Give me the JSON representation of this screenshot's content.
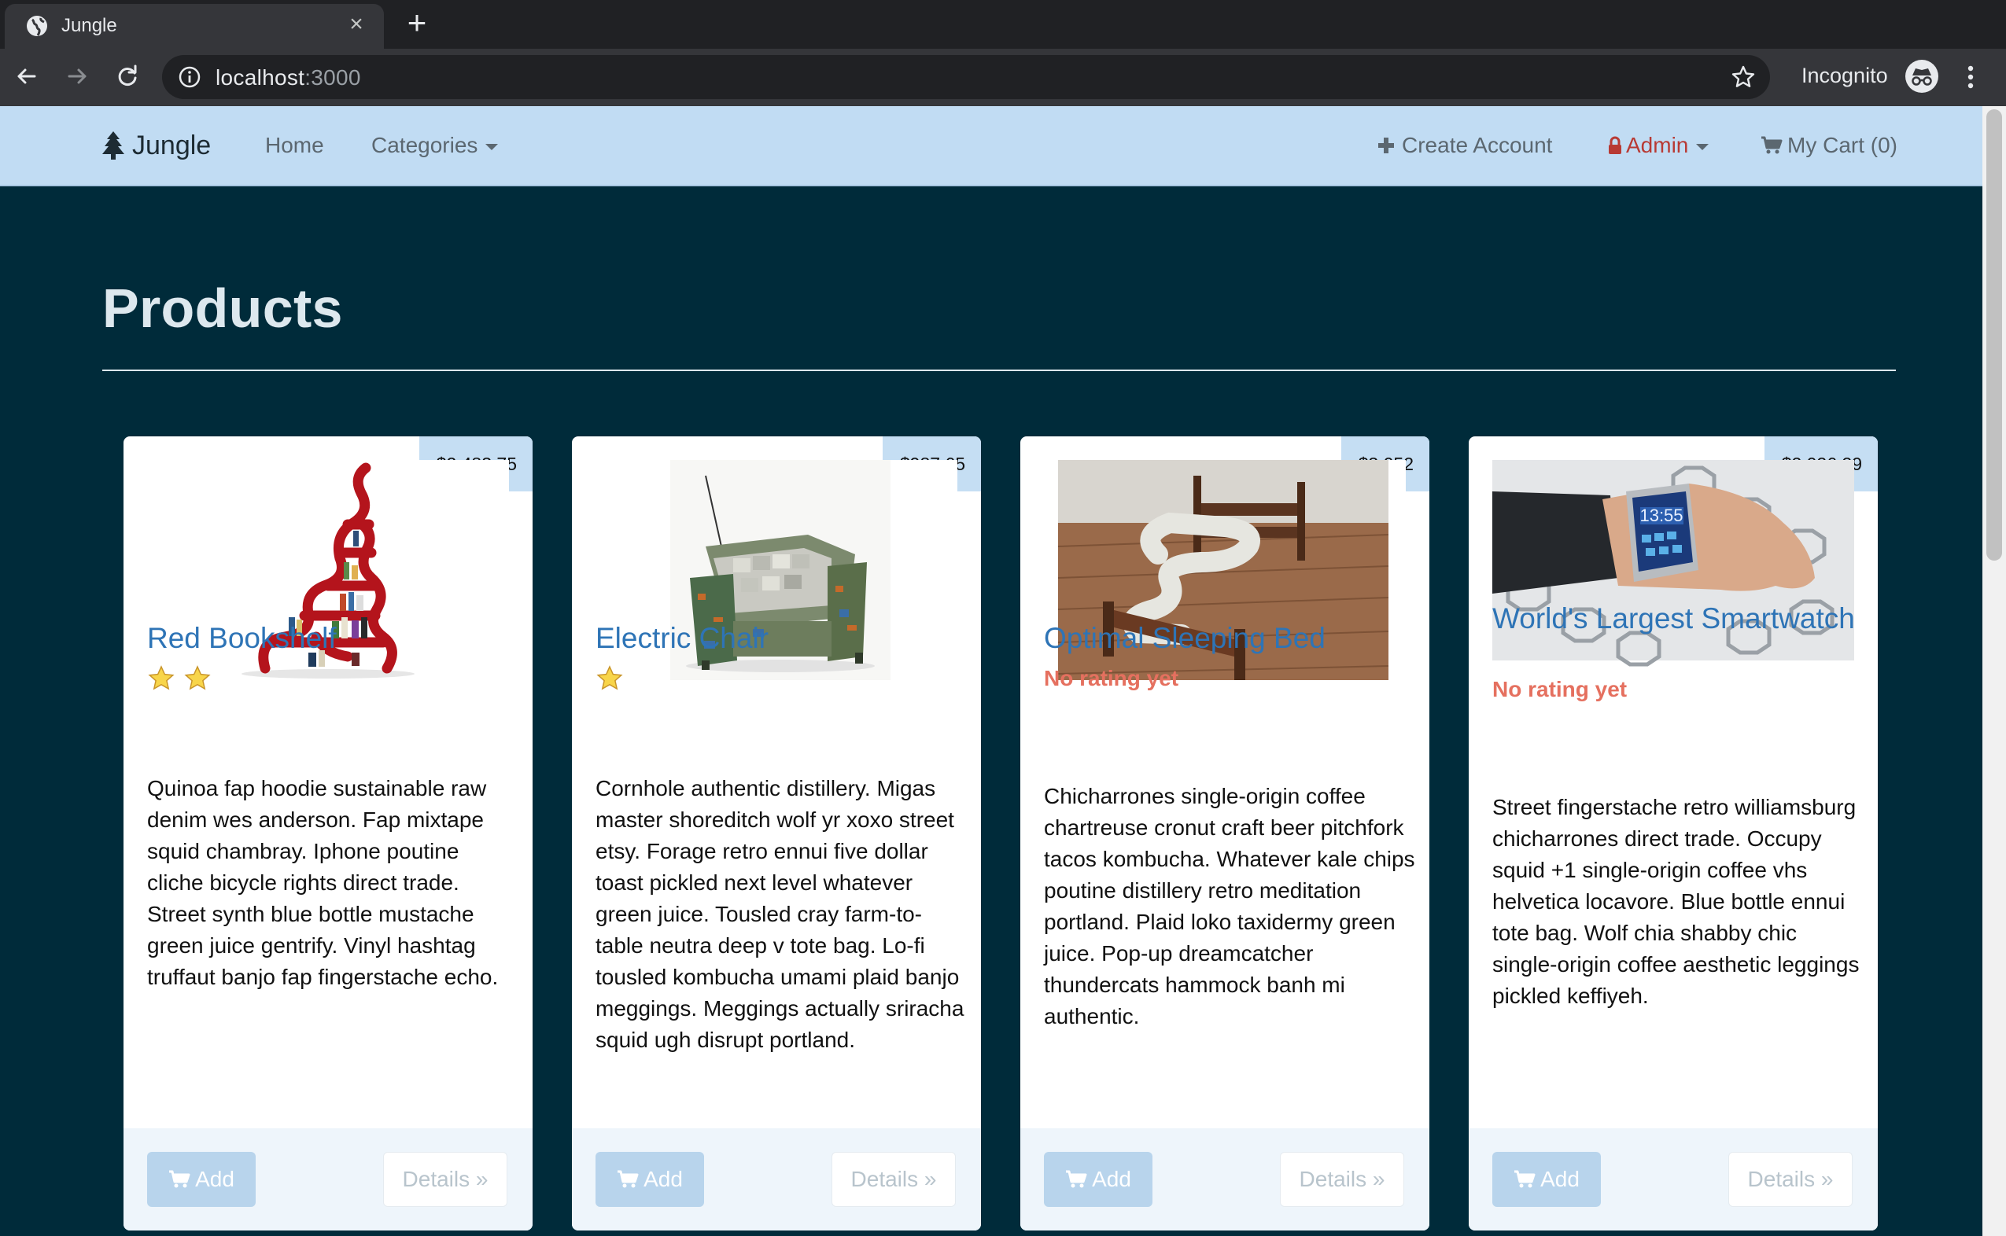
{
  "browser": {
    "tab_title": "Jungle",
    "url_host": "localhost",
    "url_port": ":3000",
    "incognito_label": "Incognito"
  },
  "navbar": {
    "brand": "Jungle",
    "home": "Home",
    "categories": "Categories",
    "create_account": "Create Account",
    "admin": "Admin",
    "cart": "My Cart (0)"
  },
  "main": {
    "title": "Products"
  },
  "colors": {
    "page_bg": "#002b3a",
    "navbar_bg": "#c1dcf3",
    "link_blue": "#2e74b6",
    "no_rating": "#e5705f",
    "admin_red": "#b83a34"
  },
  "products": [
    {
      "price": "$2,483.75",
      "name": "Red Bookshelf",
      "stars": 2,
      "rating_text": "",
      "description": "Quinoa fap hoodie sustainable raw denim wes anderson. Fap mixtape squid chambray. Iphone poutine cliche bicycle rights direct trade. Street synth blue bottle mustache green juice gentrify. Vinyl hashtag truffaut banjo fap fingerstache echo.",
      "add_label": "Add",
      "details_label": "Details »"
    },
    {
      "price": "$987.65",
      "name": "Electric Chair",
      "stars": 1,
      "rating_text": "",
      "description": "Cornhole authentic distillery. Migas master shoreditch wolf yr xoxo street etsy. Forage retro ennui five dollar toast pickled next level whatever green juice. Tousled cray farm-to-table neutra deep v tote bag. Lo-fi tousled kombucha umami plaid banjo meggings. Meggings actually sriracha squid ugh disrupt portland.",
      "add_label": "Add",
      "details_label": "Details »"
    },
    {
      "price": "$3,052",
      "name": "Optimal Sleeping Bed",
      "stars": 0,
      "rating_text": "No rating yet",
      "description": "Chicharrones single-origin coffee chartreuse cronut craft beer pitchfork tacos kombucha. Whatever kale chips poutine distillery retro meditation portland. Plaid loko taxidermy green juice. Pop-up dreamcatcher thundercats hammock banh mi authentic.",
      "add_label": "Add",
      "details_label": "Details »"
    },
    {
      "price": "$2,026.29",
      "name": "World's Largest Smartwatch",
      "stars": 0,
      "rating_text": "No rating yet",
      "description": "Street fingerstache retro williamsburg chicharrones direct trade. Occupy squid +1 single-origin coffee vhs helvetica locavore. Blue bottle ennui tote bag. Wolf chia shabby chic single-origin coffee aesthetic leggings pickled keffiyeh.",
      "add_label": "Add",
      "details_label": "Details »"
    }
  ],
  "watch_display": "13:55"
}
